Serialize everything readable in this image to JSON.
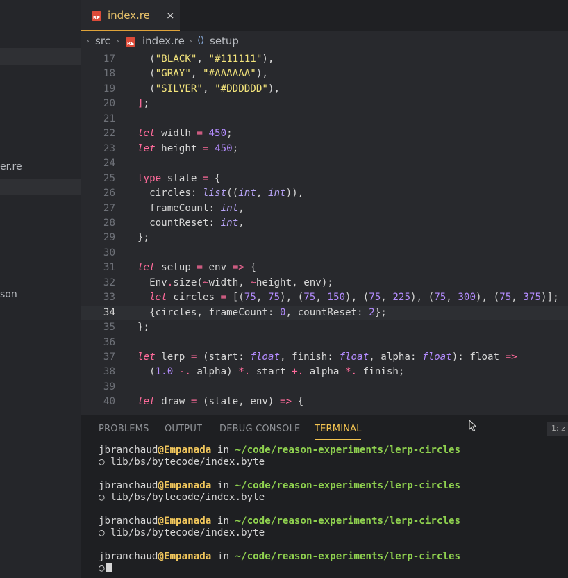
{
  "sidebar": {
    "fragments": [
      "er.re",
      "son"
    ]
  },
  "tab": {
    "title": "index.re",
    "close": "×",
    "icon_text": "RE"
  },
  "breadcrumb": {
    "folder": "src",
    "file": "index.re",
    "symbol": "setup"
  },
  "code": {
    "current_line": 34,
    "lines": [
      {
        "n": "17"
      },
      {
        "n": "18"
      },
      {
        "n": "19"
      },
      {
        "n": "20"
      },
      {
        "n": "21"
      },
      {
        "n": "22"
      },
      {
        "n": "23"
      },
      {
        "n": "24"
      },
      {
        "n": "25"
      },
      {
        "n": "26"
      },
      {
        "n": "27"
      },
      {
        "n": "28"
      },
      {
        "n": "29"
      },
      {
        "n": "30"
      },
      {
        "n": "31"
      },
      {
        "n": "32"
      },
      {
        "n": "33"
      },
      {
        "n": "34"
      },
      {
        "n": "35"
      },
      {
        "n": "36"
      },
      {
        "n": "37"
      },
      {
        "n": "38"
      },
      {
        "n": "39"
      },
      {
        "n": "40"
      }
    ]
  },
  "panel": {
    "tabs": [
      "PROBLEMS",
      "OUTPUT",
      "DEBUG CONSOLE",
      "TERMINAL"
    ],
    "active_tab": "TERMINAL",
    "terminal_selector": "1: z",
    "terminal": {
      "user": "jbranchaud",
      "at": "@",
      "host": "Empanada",
      "in": " in ",
      "path": "~/code/reason-experiments/lerp-circles",
      "output": "○ lib/bs/bytecode/index.byte",
      "prompt": "○"
    }
  },
  "colors": {
    "accent": "#f4c451",
    "keyword": "#ff6b9b",
    "string": "#f2e37b",
    "number": "#b48cff"
  }
}
